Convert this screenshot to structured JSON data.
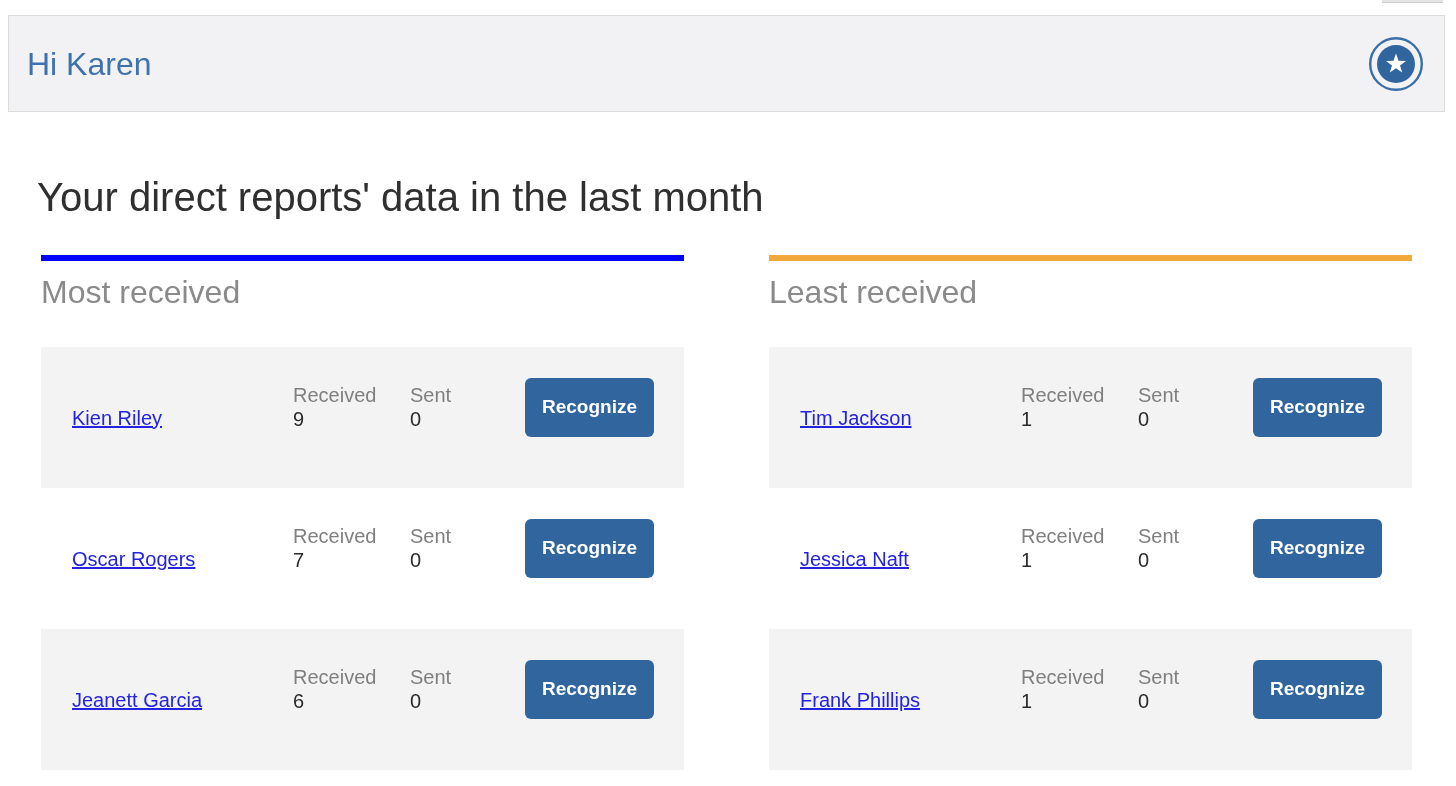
{
  "header": {
    "greeting": "Hi Karen"
  },
  "title": "Your direct reports' data in the last month",
  "panels": [
    {
      "title": "Most received",
      "color": "#0000ff",
      "rows": [
        {
          "name": "Kien Riley",
          "stats": [
            {
              "label": "Received",
              "value": "9"
            },
            {
              "label": "Sent",
              "value": "0"
            }
          ],
          "button": "Recognize"
        },
        {
          "name": "Oscar Rogers",
          "stats": [
            {
              "label": "Received",
              "value": "7"
            },
            {
              "label": "Sent",
              "value": "0"
            }
          ],
          "button": "Recognize"
        },
        {
          "name": "Jeanett Garcia",
          "stats": [
            {
              "label": "Received",
              "value": "6"
            },
            {
              "label": "Sent",
              "value": "0"
            }
          ],
          "button": "Recognize"
        }
      ]
    },
    {
      "title": "Least received",
      "color": "#f0a93a",
      "rows": [
        {
          "name": "Tim Jackson",
          "stats": [
            {
              "label": "Received",
              "value": "1"
            },
            {
              "label": "Sent",
              "value": "0"
            }
          ],
          "button": "Recognize"
        },
        {
          "name": "Jessica Naft",
          "stats": [
            {
              "label": "Received",
              "value": "1"
            },
            {
              "label": "Sent",
              "value": "0"
            }
          ],
          "button": "Recognize"
        },
        {
          "name": "Frank Phillips",
          "stats": [
            {
              "label": "Received",
              "value": "1"
            },
            {
              "label": "Sent",
              "value": "0"
            }
          ],
          "button": "Recognize"
        }
      ]
    }
  ]
}
